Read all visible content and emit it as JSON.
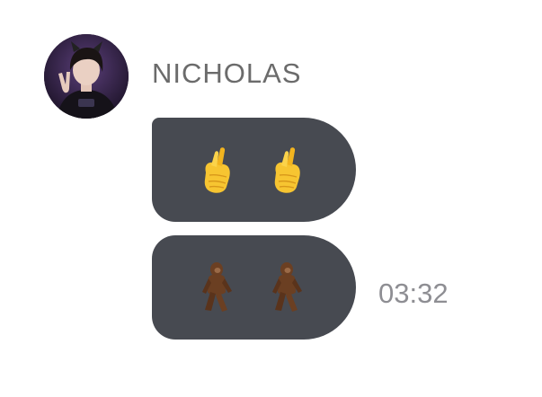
{
  "message_group": {
    "sender_name": "NICHOLAS",
    "avatar_icon": "user-avatar-photo",
    "bubble_color": "#474a51",
    "messages": [
      {
        "emojis": [
          "🫰",
          "🫰"
        ],
        "emoji_names": [
          "hand-with-index-finger-and-thumb-crossed-icon",
          "hand-with-index-finger-and-thumb-crossed-icon"
        ]
      },
      {
        "emojis": [
          "🦍",
          "🦍"
        ],
        "emoji_names": [
          "bigfoot-walking-icon",
          "bigfoot-walking-icon"
        ],
        "time": "03:32"
      }
    ]
  }
}
